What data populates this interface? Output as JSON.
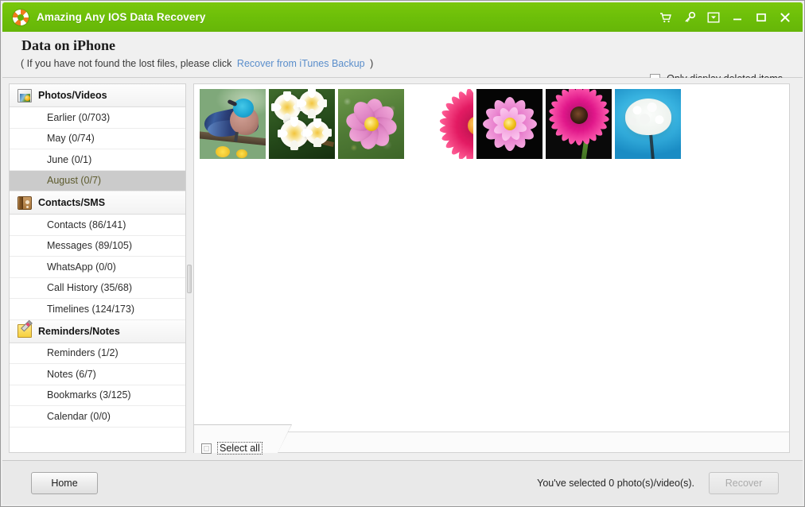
{
  "window": {
    "title": "Amazing Any IOS Data Recovery",
    "app_icon": "lifebuoy-icon",
    "accent_color": "#6dbf09",
    "controls": [
      {
        "name": "cart-icon",
        "label": "Buy"
      },
      {
        "name": "key-icon",
        "label": "Register"
      },
      {
        "name": "menu-box-icon",
        "label": "Menu"
      },
      {
        "name": "minimize-icon",
        "label": "Minimize"
      },
      {
        "name": "maximize-icon",
        "label": "Maximize"
      },
      {
        "name": "close-icon",
        "label": "Close"
      }
    ]
  },
  "header": {
    "title": "Data on iPhone",
    "subtitle_prefix": "( If you have not found the lost files, please click",
    "link": "Recover from iTunes Backup",
    "subtitle_suffix": ")",
    "link_color": "#5a8ecb",
    "only_deleted_label": "Only display deleted items",
    "only_deleted_checked": false
  },
  "sidebar": {
    "groups": [
      {
        "label": "Photos/Videos",
        "icon": "photos-icon",
        "items": [
          {
            "label": "Earlier (0/703)",
            "selected": false
          },
          {
            "label": "May (0/74)",
            "selected": false
          },
          {
            "label": "June (0/1)",
            "selected": false
          },
          {
            "label": "August (0/7)",
            "selected": true
          }
        ]
      },
      {
        "label": "Contacts/SMS",
        "icon": "contacts-book-icon",
        "items": [
          {
            "label": "Contacts (86/141)",
            "selected": false
          },
          {
            "label": "Messages (89/105)",
            "selected": false
          },
          {
            "label": "WhatsApp (0/0)",
            "selected": false
          },
          {
            "label": "Call History (35/68)",
            "selected": false
          },
          {
            "label": "Timelines (124/173)",
            "selected": false
          }
        ]
      },
      {
        "label": "Reminders/Notes",
        "icon": "note-pencil-icon",
        "items": [
          {
            "label": "Reminders (1/2)",
            "selected": false
          },
          {
            "label": "Notes (6/7)",
            "selected": false
          },
          {
            "label": "Bookmarks (3/125)",
            "selected": false
          },
          {
            "label": "Calendar (0/0)",
            "selected": false
          }
        ]
      }
    ],
    "selected_highlight_bg": "#cbcbcb",
    "selected_text_color": "#5d5b2e"
  },
  "content": {
    "thumbnails": [
      {
        "name": "thumbnail-blue-bird",
        "art": "art-bird",
        "selected": false
      },
      {
        "name": "thumbnail-frangipani",
        "art": "art-frang",
        "selected": false
      },
      {
        "name": "thumbnail-pink-cosmos",
        "art": "art-cosmos",
        "selected": false
      },
      {
        "name": "thumbnail-crimson-gerbera",
        "art": "art-gerb-w",
        "selected": false
      },
      {
        "name": "thumbnail-pink-dahlia",
        "art": "art-dahlia",
        "selected": false
      },
      {
        "name": "thumbnail-magenta-daisy",
        "art": "art-ost",
        "selected": false
      },
      {
        "name": "thumbnail-white-carnation",
        "art": "art-carn",
        "selected": false
      }
    ],
    "select_all_label": "Select all",
    "select_all_checked": false
  },
  "footer": {
    "home_label": "Home",
    "status": "You've selected 0 photo(s)/video(s).",
    "recover_label": "Recover",
    "recover_enabled": false
  }
}
